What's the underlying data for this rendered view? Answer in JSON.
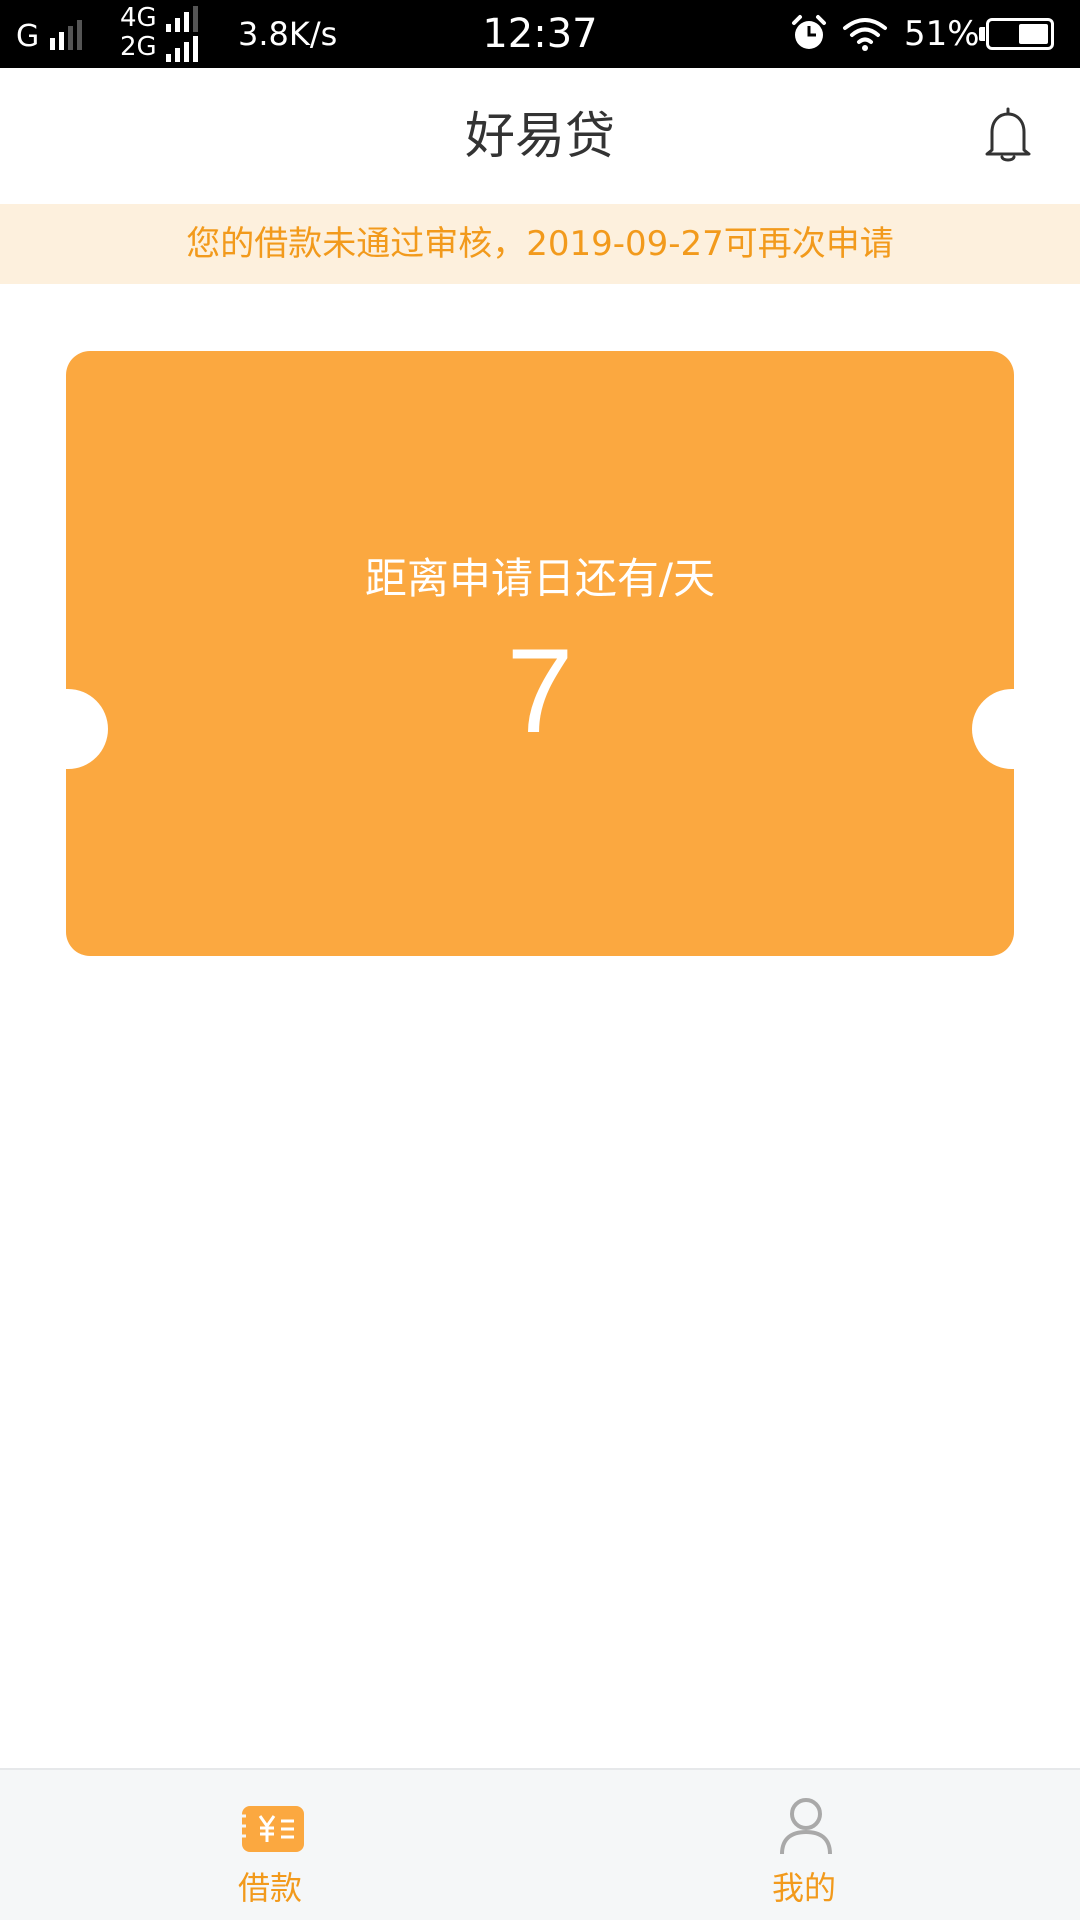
{
  "status_bar": {
    "carrier": "G",
    "network_top": "4G",
    "network_bottom": "2G",
    "speed": "3.8K/s",
    "time": "12:37",
    "battery_percent": "51%",
    "battery_level": 0.51,
    "icons": [
      "signal-icon",
      "alarm-icon",
      "wifi-icon",
      "battery-icon"
    ]
  },
  "header": {
    "title": "好易贷",
    "bell_icon": "bell-icon"
  },
  "notice": {
    "text": "您的借款未通过审核，2019-09-27可再次申请"
  },
  "countdown_card": {
    "label": "距离申请日还有/天",
    "days": "7",
    "color": "#fba840"
  },
  "tabbar": {
    "active_color": "#f29a1c",
    "tabs": [
      {
        "label": "借款",
        "icon": "loan-icon",
        "active": true
      },
      {
        "label": "我的",
        "icon": "user-icon",
        "active": false
      }
    ]
  }
}
